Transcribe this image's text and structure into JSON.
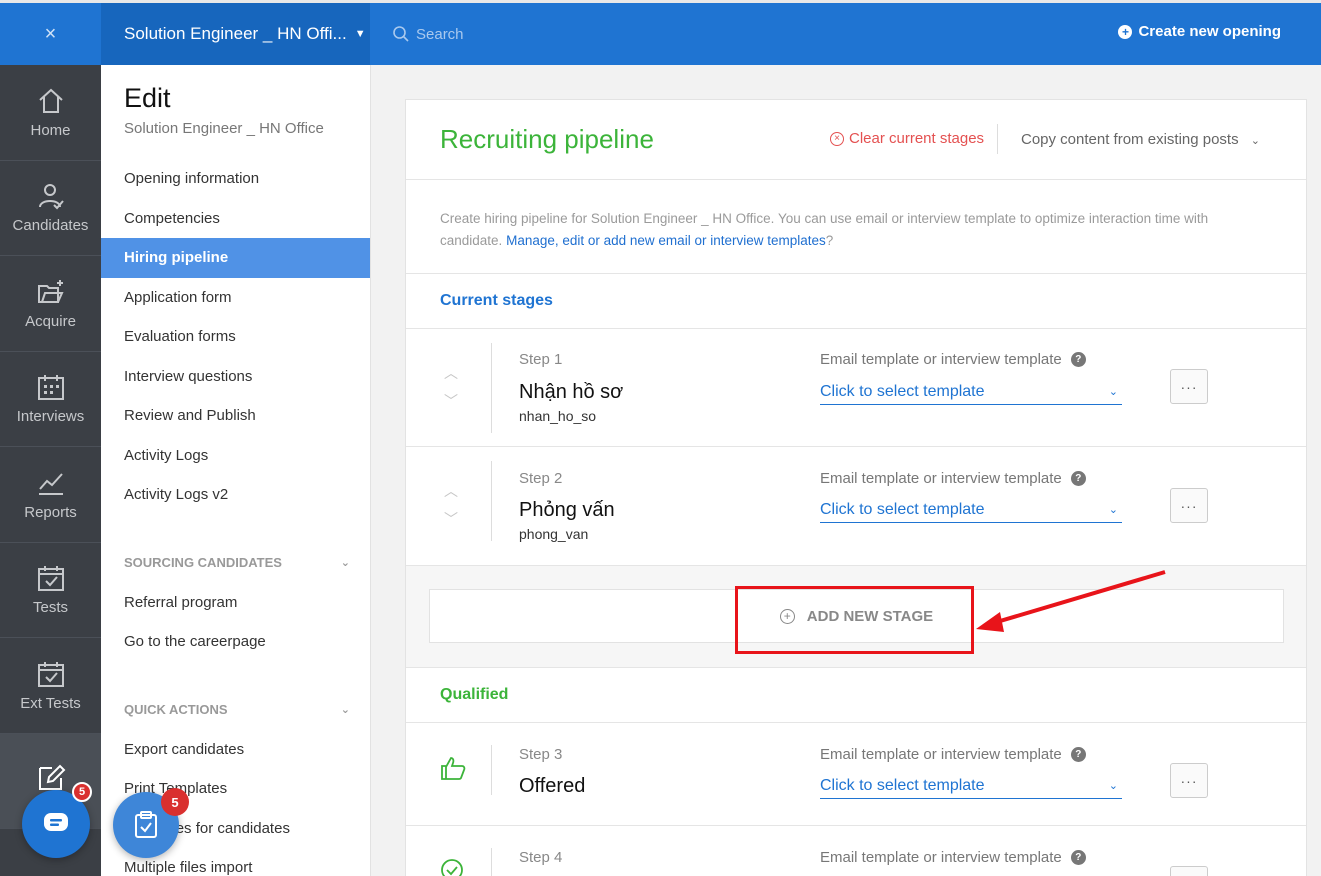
{
  "topbar": {
    "close_icon": "×",
    "opening_title": "Solution Engineer _ HN Offi...",
    "search_placeholder": "Search",
    "create_label": "Create new opening"
  },
  "rail": {
    "items": [
      {
        "label": "Home",
        "icon": "home-icon"
      },
      {
        "label": "Candidates",
        "icon": "candidates-icon"
      },
      {
        "label": "Acquire",
        "icon": "folder-plus-icon"
      },
      {
        "label": "Interviews",
        "icon": "calendar-icon"
      },
      {
        "label": "Reports",
        "icon": "chart-line-icon"
      },
      {
        "label": "Tests",
        "icon": "calendar-check-icon"
      },
      {
        "label": "Ext Tests",
        "icon": "calendar-check-icon"
      }
    ]
  },
  "sidebar": {
    "title": "Edit",
    "subtitle": "Solution Engineer _ HN Office",
    "menu": [
      "Opening information",
      "Competencies",
      "Hiring pipeline",
      "Application form",
      "Evaluation forms",
      "Interview questions",
      "Review and Publish",
      "Activity Logs",
      "Activity Logs v2"
    ],
    "sourcing_title": "SOURCING CANDIDATES",
    "sourcing_items": [
      "Referral program",
      "Go to the careerpage"
    ],
    "quick_title": "QUICK ACTIONS",
    "quick_items": [
      "Export candidates",
      "Print Templates",
      "Add notes for candidates",
      "Multiple files import"
    ]
  },
  "pipeline": {
    "title": "Recruiting pipeline",
    "clear_label": "Clear current stages",
    "copy_label": "Copy content from existing posts",
    "description": "Create hiring pipeline for Solution Engineer _ HN Office. You can use email or interview template to optimize interaction time with candidate.",
    "description_link": "Manage, edit or add new email or interview templates",
    "description_end": "?",
    "current_title": "Current stages",
    "template_label": "Email template or interview template",
    "template_placeholder": "Click to select template",
    "add_stage_label": "ADD NEW STAGE",
    "qualified_title": "Qualified",
    "stages": [
      {
        "step": "Step 1",
        "name": "Nhận hồ sơ",
        "code": "nhan_ho_so"
      },
      {
        "step": "Step 2",
        "name": "Phỏng vấn",
        "code": "phong_van"
      }
    ],
    "qualified_stages": [
      {
        "step": "Step 3",
        "name": "Offered"
      },
      {
        "step": "Step 4",
        "name": ""
      }
    ]
  },
  "badges": {
    "chat_count": "5",
    "task_count": "5"
  },
  "colors": {
    "brand": "#1f74d2",
    "accent_green": "#3cb43a",
    "highlight_red": "#e8141a"
  }
}
